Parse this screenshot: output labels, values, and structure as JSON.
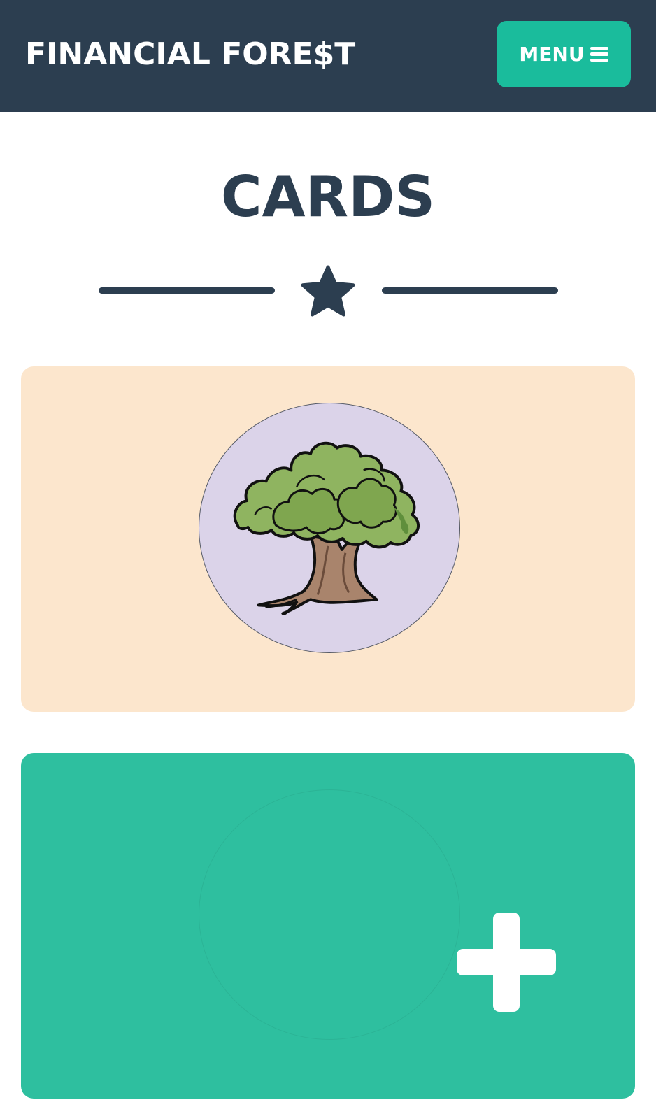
{
  "header": {
    "brand": "FINANCIAL FORE$T",
    "menu_label": "MENU",
    "menu_icon": "hamburger-icon",
    "background_color": "#2c3e50",
    "accent_color": "#1abc9c"
  },
  "main": {
    "title": "CARDS",
    "divider_icon": "star-icon",
    "cards": [
      {
        "type": "tree-card",
        "image": "tree-illustration",
        "background_color": "#fce6cd",
        "circle_color": "#dbd3e9"
      },
      {
        "type": "add-card",
        "icon": "plus-icon",
        "background_color": "#2ebf9f"
      }
    ]
  }
}
